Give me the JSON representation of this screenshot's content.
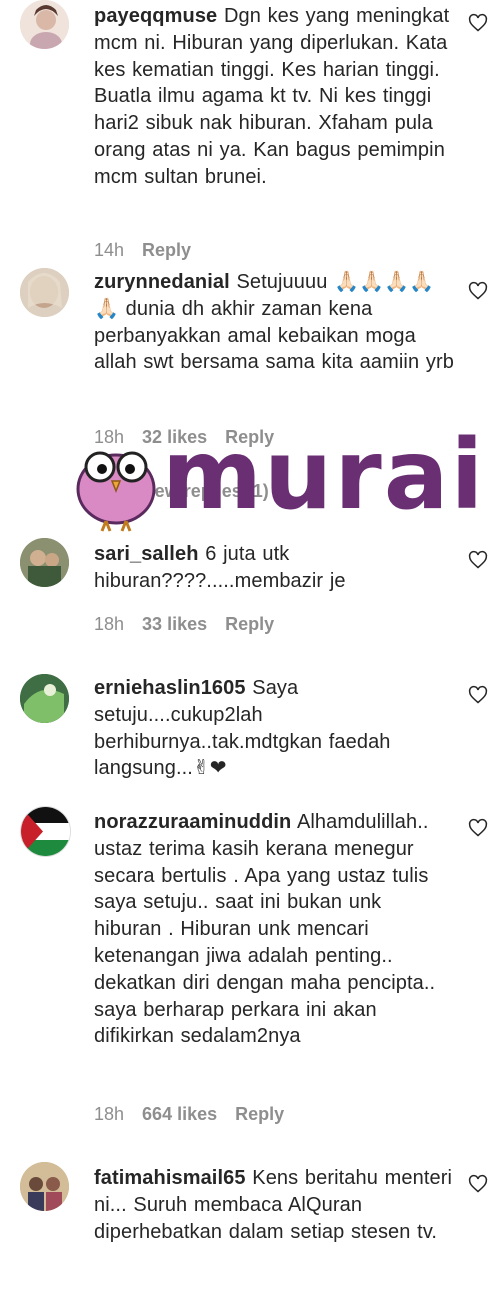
{
  "comments": [
    {
      "username": "payeqqmuse",
      "text": "Dgn kes yang meningkat mcm ni. Hiburan yang diperlukan. Kata kes kematian tinggi. Kes harian tinggi. Buatla ilmu agama kt tv. Ni kes tinggi hari2 sibuk nak hiburan. Xfaham pula orang atas ni ya. Kan bagus pemimpin mcm sultan brunei.",
      "time": "14h",
      "likes": "",
      "reply": "Reply"
    },
    {
      "username": "zurynnedanial",
      "text": "Setujuuuu 🙏🏻🙏🏻🙏🏻🙏🏻🙏🏻 dunia dh akhir zaman kena perbanyakkan amal kebaikan moga allah swt bersama sama kita aamiin yrb",
      "time": "18h",
      "likes": "32 likes",
      "reply": "Reply"
    },
    {
      "username": "sari_salleh",
      "text": "6 juta utk hiburan????.....membazir je",
      "time": "18h",
      "likes": "33 likes",
      "reply": "Reply"
    },
    {
      "username": "erniehaslin1605",
      "text": "Saya setuju....cukup2lah berhiburnya..tak.mdtgkan faedah langsung...✌❤",
      "time": "",
      "likes": "",
      "reply": ""
    },
    {
      "username": "norazzuraaminuddin",
      "text": "Alhamdulillah.. ustaz terima kasih kerana menegur secara bertulis . Apa yang ustaz tulis saya setuju.. saat ini bukan unk hiburan . Hiburan unk mencari ketenangan jiwa adalah penting.. dekatkan diri dengan maha pencipta.. saya berharap perkara ini akan difikirkan sedalam2nya",
      "time": "18h",
      "likes": "664 likes",
      "reply": "Reply"
    },
    {
      "username": "fatimahismail65",
      "text": "Kens beritahu menteri ni... Suruh membaca AlQuran diperhebatkan dalam setiap stesen tv.",
      "time": "",
      "likes": "",
      "reply": ""
    }
  ],
  "view_replies": "View replies (1)",
  "watermark": "murai",
  "colors": {
    "text": "#262626",
    "muted": "#8e8e8e",
    "logo_purple": "#6a2f73",
    "owl_pink": "#d98ac4"
  },
  "icons": {
    "like": "heart-outline-icon"
  }
}
